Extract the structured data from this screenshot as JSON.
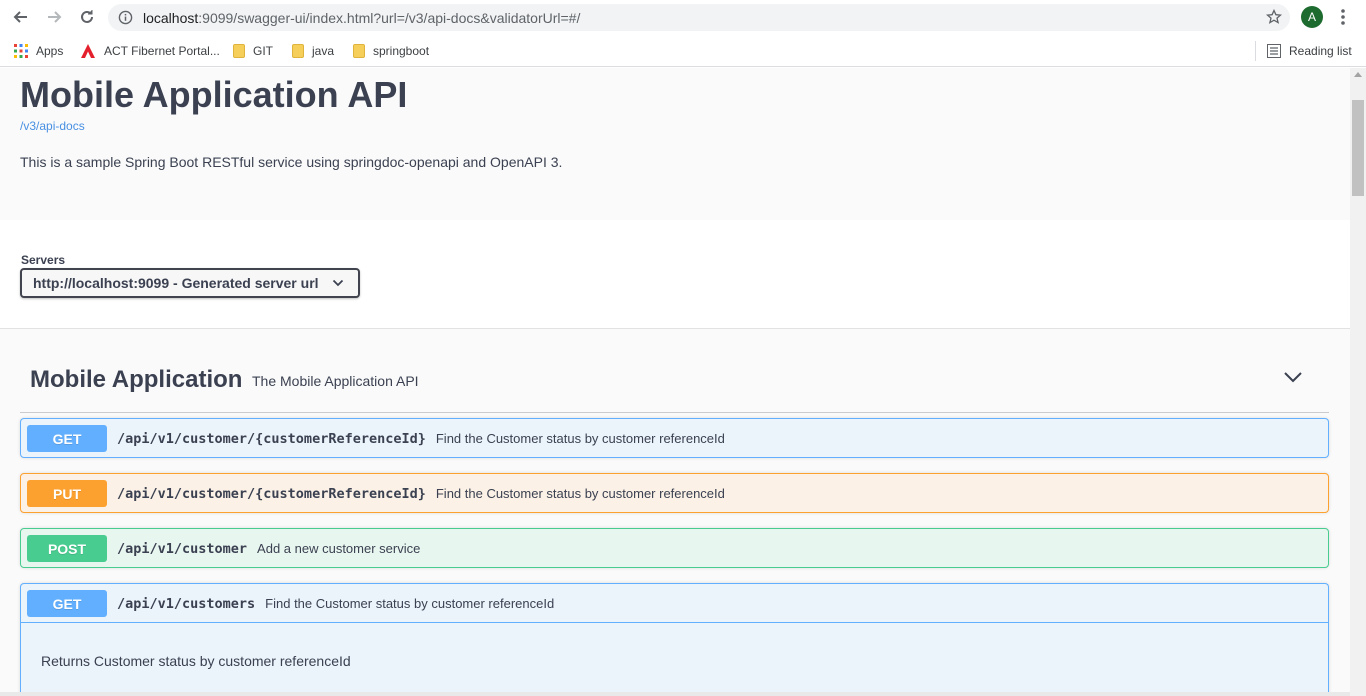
{
  "browser": {
    "url_host": "localhost",
    "url_rest": ":9099/swagger-ui/index.html?url=/v3/api-docs&validatorUrl=#/",
    "avatar_letter": "A",
    "bookmarks": [
      {
        "label": "Apps",
        "icon": "apps-grid-icon"
      },
      {
        "label": "ACT Fibernet Portal...",
        "icon": "act-logo-icon"
      },
      {
        "label": "GIT",
        "icon": "folder-icon"
      },
      {
        "label": "java",
        "icon": "folder-icon"
      },
      {
        "label": "springboot",
        "icon": "folder-icon"
      }
    ],
    "reading_list": "Reading list"
  },
  "info": {
    "title": "Mobile Application API",
    "spec_link": "/v3/api-docs",
    "description": "This is a sample Spring Boot RESTful service using springdoc-openapi and OpenAPI 3."
  },
  "servers": {
    "label": "Servers",
    "selected": "http://localhost:9099 - Generated server url"
  },
  "tag": {
    "name": "Mobile Application",
    "description": "The Mobile Application API"
  },
  "operations": [
    {
      "method": "GET",
      "path": "/api/v1/customer/{customerReferenceId}",
      "summary": "Find the Customer status by customer referenceId"
    },
    {
      "method": "PUT",
      "path": "/api/v1/customer/{customerReferenceId}",
      "summary": "Find the Customer status by customer referenceId"
    },
    {
      "method": "POST",
      "path": "/api/v1/customer",
      "summary": "Add a new customer service"
    },
    {
      "method": "GET",
      "path": "/api/v1/customers",
      "summary": "Find the Customer status by customer referenceId",
      "description": "Returns Customer status by customer referenceId"
    }
  ],
  "colors": {
    "get": "#61affe",
    "put": "#fca130",
    "post": "#49cc90",
    "link": "#4990e2",
    "text": "#3b4151"
  }
}
